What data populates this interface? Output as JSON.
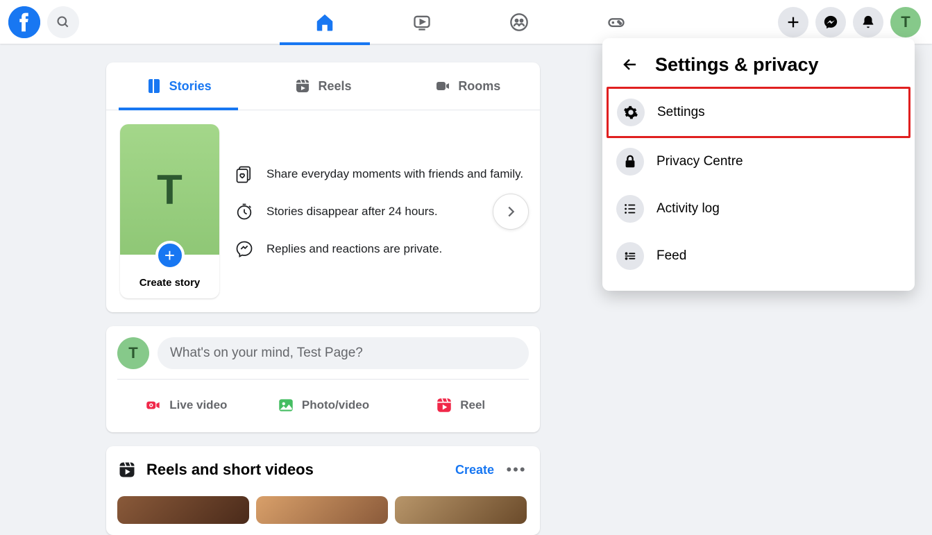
{
  "header": {
    "avatar_initial": "T"
  },
  "story_tabs": [
    {
      "label": "Stories",
      "active": true
    },
    {
      "label": "Reels",
      "active": false
    },
    {
      "label": "Rooms",
      "active": false
    }
  ],
  "create_story": {
    "initial": "T",
    "label": "Create story"
  },
  "story_info": [
    "Share everyday moments with friends and family.",
    "Stories disappear after 24 hours.",
    "Replies and reactions are private."
  ],
  "composer": {
    "avatar_initial": "T",
    "placeholder": "What's on your mind, Test Page?",
    "actions": [
      {
        "label": "Live video",
        "color": "#f02849"
      },
      {
        "label": "Photo/video",
        "color": "#45bd62"
      },
      {
        "label": "Reel",
        "color": "#f02849"
      }
    ]
  },
  "reels_section": {
    "title": "Reels and short videos",
    "create_label": "Create"
  },
  "dropdown": {
    "title": "Settings & privacy",
    "items": [
      {
        "label": "Settings",
        "highlighted": true
      },
      {
        "label": "Privacy Centre",
        "highlighted": false
      },
      {
        "label": "Activity log",
        "highlighted": false
      },
      {
        "label": "Feed",
        "highlighted": false
      }
    ]
  }
}
